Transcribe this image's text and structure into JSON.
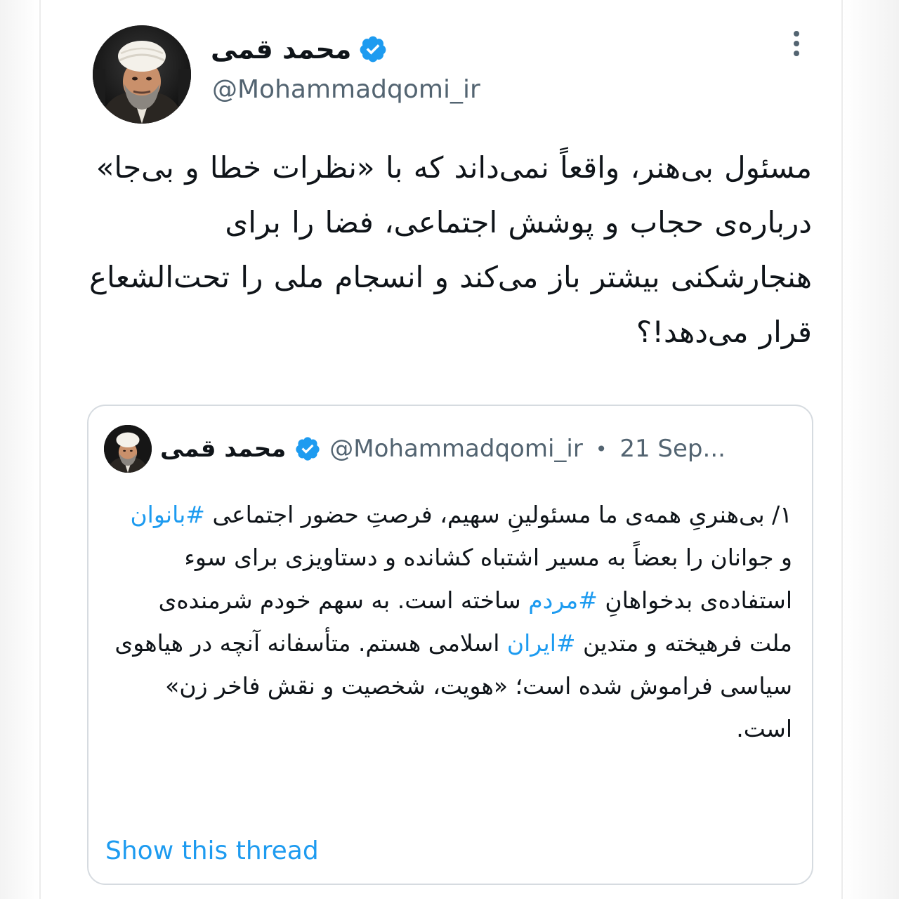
{
  "tweet": {
    "author": {
      "name": "محمد قمی",
      "handle": "@Mohammadqomi_ir",
      "verified": true,
      "avatar_icon": "cleric-portrait-avatar"
    },
    "more_icon": "more-options-icon",
    "text": "مسئول بی‌هنر، واقعاً نمی‌داند که با «نظرات خطا و بی‌جا» درباره‌ی حجاب و پوشش اجتماعی، فضا را برای هنجارشکنی بیشتر  باز می‌کند و انسجام ملی را تحت‌الشعاع قرار می‌دهد!؟"
  },
  "quoted_tweet": {
    "author": {
      "name": "محمد قمی",
      "handle": "@Mohammadqomi_ir",
      "verified": true,
      "avatar_icon": "cleric-portrait-avatar"
    },
    "separator": "•",
    "date": "21 Sep...",
    "text_segments": [
      {
        "text": "۱/ بی‌هنریِ همه‌ی ما مسئولینِ سهیم، فرصتِ حضور اجتماعی ",
        "type": "text"
      },
      {
        "text": "#بانوان",
        "type": "hashtag"
      },
      {
        "text": " و جوانان را بعضاً به مسیر اشتباه کشانده و دستاویزی برای سوء استفاده‌ی بدخواهانِ ",
        "type": "text"
      },
      {
        "text": "#مردم",
        "type": "hashtag"
      },
      {
        "text": " ساخته است. به سهم خودم شرمنده‌ی ملت فرهیخته و متدین ",
        "type": "text"
      },
      {
        "text": "#ایران",
        "type": "hashtag"
      },
      {
        "text": " اسلامی هستم. متأسفانه آنچه در هیاهوی سیاسی فراموش شده است؛ «هویت، شخصیت و نقش فاخر زن» است.",
        "type": "text"
      }
    ],
    "show_thread_label": "Show this thread"
  },
  "colors": {
    "link_blue": "#1d9bf0",
    "secondary_text": "#536471",
    "primary_text": "#0f1419",
    "border": "#d6dbe0"
  }
}
